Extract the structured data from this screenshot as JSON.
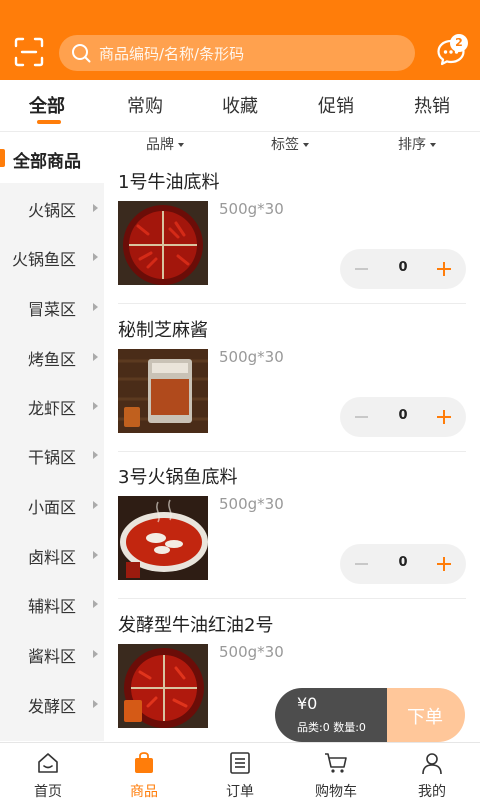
{
  "header": {
    "search_placeholder": "商品编码/名称/条形码",
    "message_badge": "2",
    "icons": {
      "scan": "scan-icon",
      "search": "search-icon",
      "messages": "chat-bubble-icon"
    },
    "colors": {
      "brand": "#ff7d0a"
    }
  },
  "tabs": [
    {
      "label": "全部",
      "active": true
    },
    {
      "label": "常购",
      "active": false
    },
    {
      "label": "收藏",
      "active": false
    },
    {
      "label": "促销",
      "active": false
    },
    {
      "label": "热销",
      "active": false
    }
  ],
  "sidebar": {
    "all_label": "全部商品",
    "items": [
      "火锅区",
      "火锅鱼区",
      "冒菜区",
      "烤鱼区",
      "龙虾区",
      "干锅区",
      "小面区",
      "卤料区",
      "辅料区",
      "酱料区",
      "发酵区"
    ]
  },
  "filters": [
    {
      "label": "品牌"
    },
    {
      "label": "标签"
    },
    {
      "label": "排序"
    }
  ],
  "products": [
    {
      "name": "1号牛油底料",
      "spec": "500g*30",
      "quantity": "0"
    },
    {
      "name": "秘制芝麻酱",
      "spec": "500g*30",
      "quantity": "0"
    },
    {
      "name": "3号火锅鱼底料",
      "spec": "500g*30",
      "quantity": "0"
    },
    {
      "name": "发酵型牛油红油2号",
      "spec": "500g*30",
      "quantity": "0"
    }
  ],
  "cart": {
    "price": "¥0",
    "stats": "品类:0 数量:0",
    "order_label": "下单"
  },
  "bottom_nav": [
    {
      "label": "首页",
      "icon": "home-icon",
      "active": false
    },
    {
      "label": "商品",
      "icon": "shopping-bag-icon",
      "active": true
    },
    {
      "label": "订单",
      "icon": "order-list-icon",
      "active": false
    },
    {
      "label": "购物车",
      "icon": "cart-icon",
      "active": false
    },
    {
      "label": "我的",
      "icon": "user-icon",
      "active": false
    }
  ]
}
